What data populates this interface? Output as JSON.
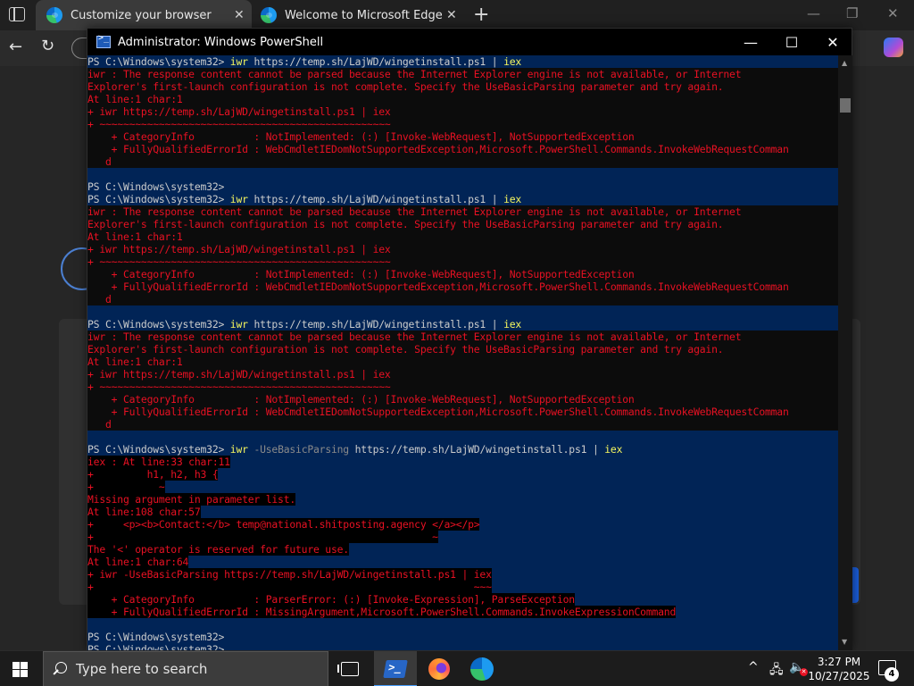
{
  "browser": {
    "tabs": [
      {
        "title": "Customize your browser",
        "active": true
      },
      {
        "title": "Welcome to Microsoft Edge",
        "active": false
      }
    ],
    "new_tab_glyph": "+",
    "window_controls": {
      "minimize": "—",
      "restore": "❐",
      "close": "✕"
    }
  },
  "powershell": {
    "title": "Administrator: Windows PowerShell",
    "controls": {
      "minimize": "—",
      "maximize": "☐",
      "close": "✕"
    },
    "lines": [
      {
        "hl": true,
        "segs": [
          {
            "t": "PS C:\\Windows\\system32> ",
            "c": "p"
          },
          {
            "t": "iwr",
            "c": "cmd"
          },
          {
            "t": " https://temp.sh/LajWD/wingetinstall.ps1 ",
            "c": "url"
          },
          {
            "t": "| ",
            "c": "p"
          },
          {
            "t": "iex",
            "c": "cmd"
          }
        ]
      },
      {
        "hl": false,
        "segs": [
          {
            "t": "iwr : The response content cannot be parsed because the Internet Explorer engine is not available, or Internet",
            "c": "err"
          }
        ]
      },
      {
        "hl": false,
        "segs": [
          {
            "t": "Explorer's first-launch configuration is not complete. Specify the UseBasicParsing parameter and try again.",
            "c": "err"
          }
        ]
      },
      {
        "hl": false,
        "segs": [
          {
            "t": "At line:1 char:1",
            "c": "err"
          }
        ]
      },
      {
        "hl": false,
        "segs": [
          {
            "t": "+ iwr https://temp.sh/LajWD/wingetinstall.ps1 | iex",
            "c": "err"
          }
        ]
      },
      {
        "hl": false,
        "segs": [
          {
            "t": "+ ~~~~~~~~~~~~~~~~~~~~~~~~~~~~~~~~~~~~~~~~~~~~~~~~~",
            "c": "err"
          }
        ]
      },
      {
        "hl": false,
        "segs": [
          {
            "t": "    + CategoryInfo          : NotImplemented: (:) [Invoke-WebRequest], NotSupportedException",
            "c": "err"
          }
        ]
      },
      {
        "hl": false,
        "segs": [
          {
            "t": "    + FullyQualifiedErrorId : WebCmdletIEDomNotSupportedException,Microsoft.PowerShell.Commands.InvokeWebRequestComman",
            "c": "err"
          }
        ]
      },
      {
        "hl": false,
        "segs": [
          {
            "t": "   d",
            "c": "err"
          }
        ]
      },
      {
        "hl": true,
        "segs": [
          {
            "t": " ",
            "c": "p"
          }
        ]
      },
      {
        "hl": true,
        "segs": [
          {
            "t": "PS C:\\Windows\\system32>",
            "c": "p"
          }
        ]
      },
      {
        "hl": true,
        "segs": [
          {
            "t": "PS C:\\Windows\\system32> ",
            "c": "p"
          },
          {
            "t": "iwr",
            "c": "cmd"
          },
          {
            "t": " https://temp.sh/LajWD/wingetinstall.ps1 ",
            "c": "url"
          },
          {
            "t": "| ",
            "c": "p"
          },
          {
            "t": "iex",
            "c": "cmd"
          }
        ]
      },
      {
        "hl": false,
        "segs": [
          {
            "t": "iwr : The response content cannot be parsed because the Internet Explorer engine is not available, or Internet",
            "c": "err"
          }
        ]
      },
      {
        "hl": false,
        "segs": [
          {
            "t": "Explorer's first-launch configuration is not complete. Specify the UseBasicParsing parameter and try again.",
            "c": "err"
          }
        ]
      },
      {
        "hl": false,
        "segs": [
          {
            "t": "At line:1 char:1",
            "c": "err"
          }
        ]
      },
      {
        "hl": false,
        "segs": [
          {
            "t": "+ iwr https://temp.sh/LajWD/wingetinstall.ps1 | iex",
            "c": "err"
          }
        ]
      },
      {
        "hl": false,
        "segs": [
          {
            "t": "+ ~~~~~~~~~~~~~~~~~~~~~~~~~~~~~~~~~~~~~~~~~~~~~~~~~",
            "c": "err"
          }
        ]
      },
      {
        "hl": false,
        "segs": [
          {
            "t": "    + CategoryInfo          : NotImplemented: (:) [Invoke-WebRequest], NotSupportedException",
            "c": "err"
          }
        ]
      },
      {
        "hl": false,
        "segs": [
          {
            "t": "    + FullyQualifiedErrorId : WebCmdletIEDomNotSupportedException,Microsoft.PowerShell.Commands.InvokeWebRequestComman",
            "c": "err"
          }
        ]
      },
      {
        "hl": false,
        "segs": [
          {
            "t": "   d",
            "c": "err"
          }
        ]
      },
      {
        "hl": true,
        "segs": [
          {
            "t": " ",
            "c": "p"
          }
        ]
      },
      {
        "hl": true,
        "segs": [
          {
            "t": "PS C:\\Windows\\system32> ",
            "c": "p"
          },
          {
            "t": "iwr",
            "c": "cmd"
          },
          {
            "t": " https://temp.sh/LajWD/wingetinstall.ps1 ",
            "c": "url"
          },
          {
            "t": "| ",
            "c": "p"
          },
          {
            "t": "iex",
            "c": "cmd"
          }
        ]
      },
      {
        "hl": false,
        "segs": [
          {
            "t": "iwr : The response content cannot be parsed because the Internet Explorer engine is not available, or Internet",
            "c": "err"
          }
        ]
      },
      {
        "hl": false,
        "segs": [
          {
            "t": "Explorer's first-launch configuration is not complete. Specify the UseBasicParsing parameter and try again.",
            "c": "err"
          }
        ]
      },
      {
        "hl": false,
        "segs": [
          {
            "t": "At line:1 char:1",
            "c": "err"
          }
        ]
      },
      {
        "hl": false,
        "segs": [
          {
            "t": "+ iwr https://temp.sh/LajWD/wingetinstall.ps1 | iex",
            "c": "err"
          }
        ]
      },
      {
        "hl": false,
        "segs": [
          {
            "t": "+ ~~~~~~~~~~~~~~~~~~~~~~~~~~~~~~~~~~~~~~~~~~~~~~~~~",
            "c": "err"
          }
        ]
      },
      {
        "hl": false,
        "segs": [
          {
            "t": "    + CategoryInfo          : NotImplemented: (:) [Invoke-WebRequest], NotSupportedException",
            "c": "err"
          }
        ]
      },
      {
        "hl": false,
        "segs": [
          {
            "t": "    + FullyQualifiedErrorId : WebCmdletIEDomNotSupportedException,Microsoft.PowerShell.Commands.InvokeWebRequestComman",
            "c": "err"
          }
        ]
      },
      {
        "hl": false,
        "segs": [
          {
            "t": "   d",
            "c": "err"
          }
        ]
      },
      {
        "hl": true,
        "segs": [
          {
            "t": " ",
            "c": "p"
          }
        ]
      },
      {
        "hl": true,
        "segs": [
          {
            "t": "PS C:\\Windows\\system32> ",
            "c": "p"
          },
          {
            "t": "iwr",
            "c": "cmd"
          },
          {
            "t": " -UseBasicParsing ",
            "c": "par"
          },
          {
            "t": "https://temp.sh/LajWD/wingetinstall.ps1 ",
            "c": "url"
          },
          {
            "t": "| ",
            "c": "p"
          },
          {
            "t": "iex",
            "c": "cmd"
          }
        ]
      },
      {
        "hl": true,
        "segs": [
          {
            "t": "iex : At line:33 char:11",
            "c": "errhl"
          }
        ]
      },
      {
        "hl": true,
        "segs": [
          {
            "t": "+         h1, h2, h3 {",
            "c": "errhl"
          }
        ]
      },
      {
        "hl": true,
        "segs": [
          {
            "t": "+           ~",
            "c": "errhl"
          }
        ]
      },
      {
        "hl": true,
        "segs": [
          {
            "t": "Missing argument in parameter list.",
            "c": "errhl"
          }
        ]
      },
      {
        "hl": true,
        "segs": [
          {
            "t": "At line:108 char:57",
            "c": "errhl"
          }
        ]
      },
      {
        "hl": true,
        "segs": [
          {
            "t": "+     <p><b>Contact:</b> temp@national.shitposting.agency </a></p>",
            "c": "errhl"
          }
        ]
      },
      {
        "hl": true,
        "segs": [
          {
            "t": "+                                                         ~",
            "c": "errhl"
          }
        ]
      },
      {
        "hl": true,
        "segs": [
          {
            "t": "The '<' operator is reserved for future use.",
            "c": "errhl"
          }
        ]
      },
      {
        "hl": true,
        "segs": [
          {
            "t": "At line:1 char:64",
            "c": "errhl"
          }
        ]
      },
      {
        "hl": true,
        "segs": [
          {
            "t": "+ iwr -UseBasicParsing https://temp.sh/LajWD/wingetinstall.ps1 | iex",
            "c": "errhl"
          }
        ]
      },
      {
        "hl": true,
        "segs": [
          {
            "t": "+                                                                ~~~",
            "c": "errhl"
          }
        ]
      },
      {
        "hl": true,
        "segs": [
          {
            "t": "    + CategoryInfo          : ParserError: (:) [Invoke-Expression], ParseException",
            "c": "errhl"
          }
        ]
      },
      {
        "hl": true,
        "segs": [
          {
            "t": "    + FullyQualifiedErrorId : MissingArgument,Microsoft.PowerShell.Commands.InvokeExpressionCommand",
            "c": "errhl"
          }
        ]
      },
      {
        "hl": true,
        "segs": [
          {
            "t": " ",
            "c": "p"
          }
        ]
      },
      {
        "hl": true,
        "segs": [
          {
            "t": "PS C:\\Windows\\system32>",
            "c": "p"
          }
        ]
      },
      {
        "hl": true,
        "segs": [
          {
            "t": "PS C:\\Windows\\system32>",
            "c": "p"
          }
        ]
      }
    ]
  },
  "taskbar": {
    "search_placeholder": "Type here to search",
    "apps": [
      "task-view",
      "powershell",
      "firefox",
      "edge"
    ],
    "active_app": "powershell",
    "time": "3:27 PM",
    "date": "10/27/2025",
    "notification_count": "4"
  },
  "colors": {
    "ps_highlight": "#012456",
    "ps_error": "#e81123",
    "ps_command": "#f7f75e",
    "ps_parameter": "#8a8a8a",
    "ps_text": "#cccccc"
  }
}
